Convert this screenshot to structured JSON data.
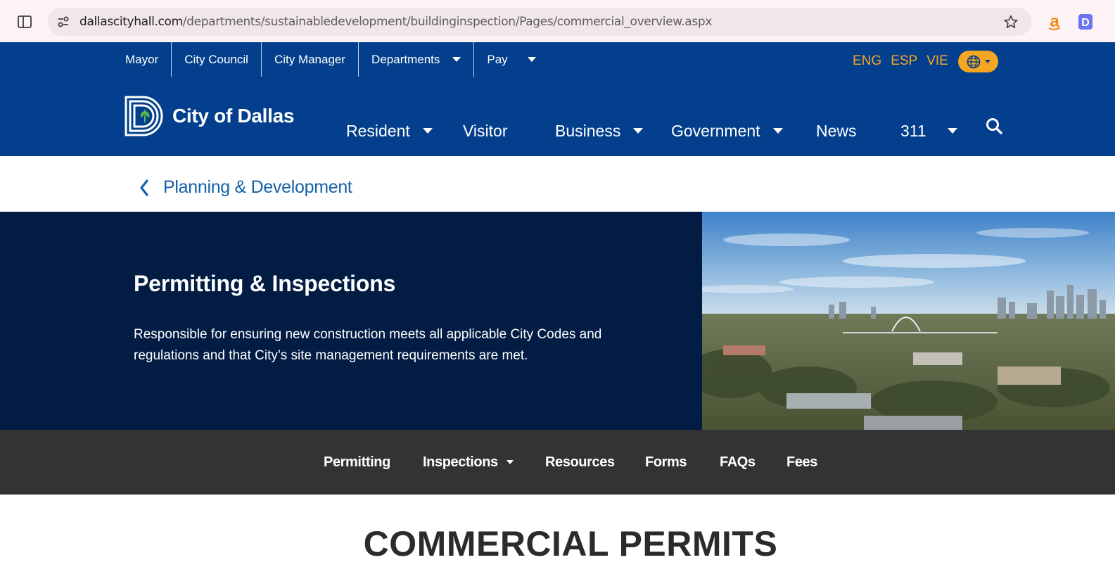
{
  "browser": {
    "url_domain": "dallascityhall.com",
    "url_path": "/departments/sustainabledevelopment/buildinginspection/Pages/commercial_overview.aspx",
    "ext_a_label": "a",
    "ext_d_label": "D"
  },
  "utility_nav": [
    {
      "label": "Mayor"
    },
    {
      "label": "City Council"
    },
    {
      "label": "City Manager"
    },
    {
      "label": "Departments"
    },
    {
      "label": "Pay"
    }
  ],
  "languages": [
    "ENG",
    "ESP",
    "VIE"
  ],
  "logo": {
    "text": "City of Dallas"
  },
  "main_nav": [
    {
      "label": "Resident"
    },
    {
      "label": "Visitor"
    },
    {
      "label": "Business"
    },
    {
      "label": "Government"
    },
    {
      "label": "News"
    },
    {
      "label": "311"
    }
  ],
  "breadcrumb": {
    "label": "Planning & Development"
  },
  "hero": {
    "title": "Permitting & Inspections",
    "description": "Responsible for ensuring new construction meets all applicable City Codes and regulations and that City’s site management requirements are met."
  },
  "sub_nav": [
    {
      "label": "Permitting"
    },
    {
      "label": "Inspections"
    },
    {
      "label": "Resources"
    },
    {
      "label": "Forms"
    },
    {
      "label": "FAQs"
    },
    {
      "label": "Fees"
    }
  ],
  "section_heading": "COMMERCIAL PERMITS",
  "colors": {
    "header_blue": "#033f8c",
    "hero_navy": "#021c44",
    "accent_orange": "#f5a623",
    "link_blue": "#1460aa",
    "subnav_gray": "#333333"
  }
}
